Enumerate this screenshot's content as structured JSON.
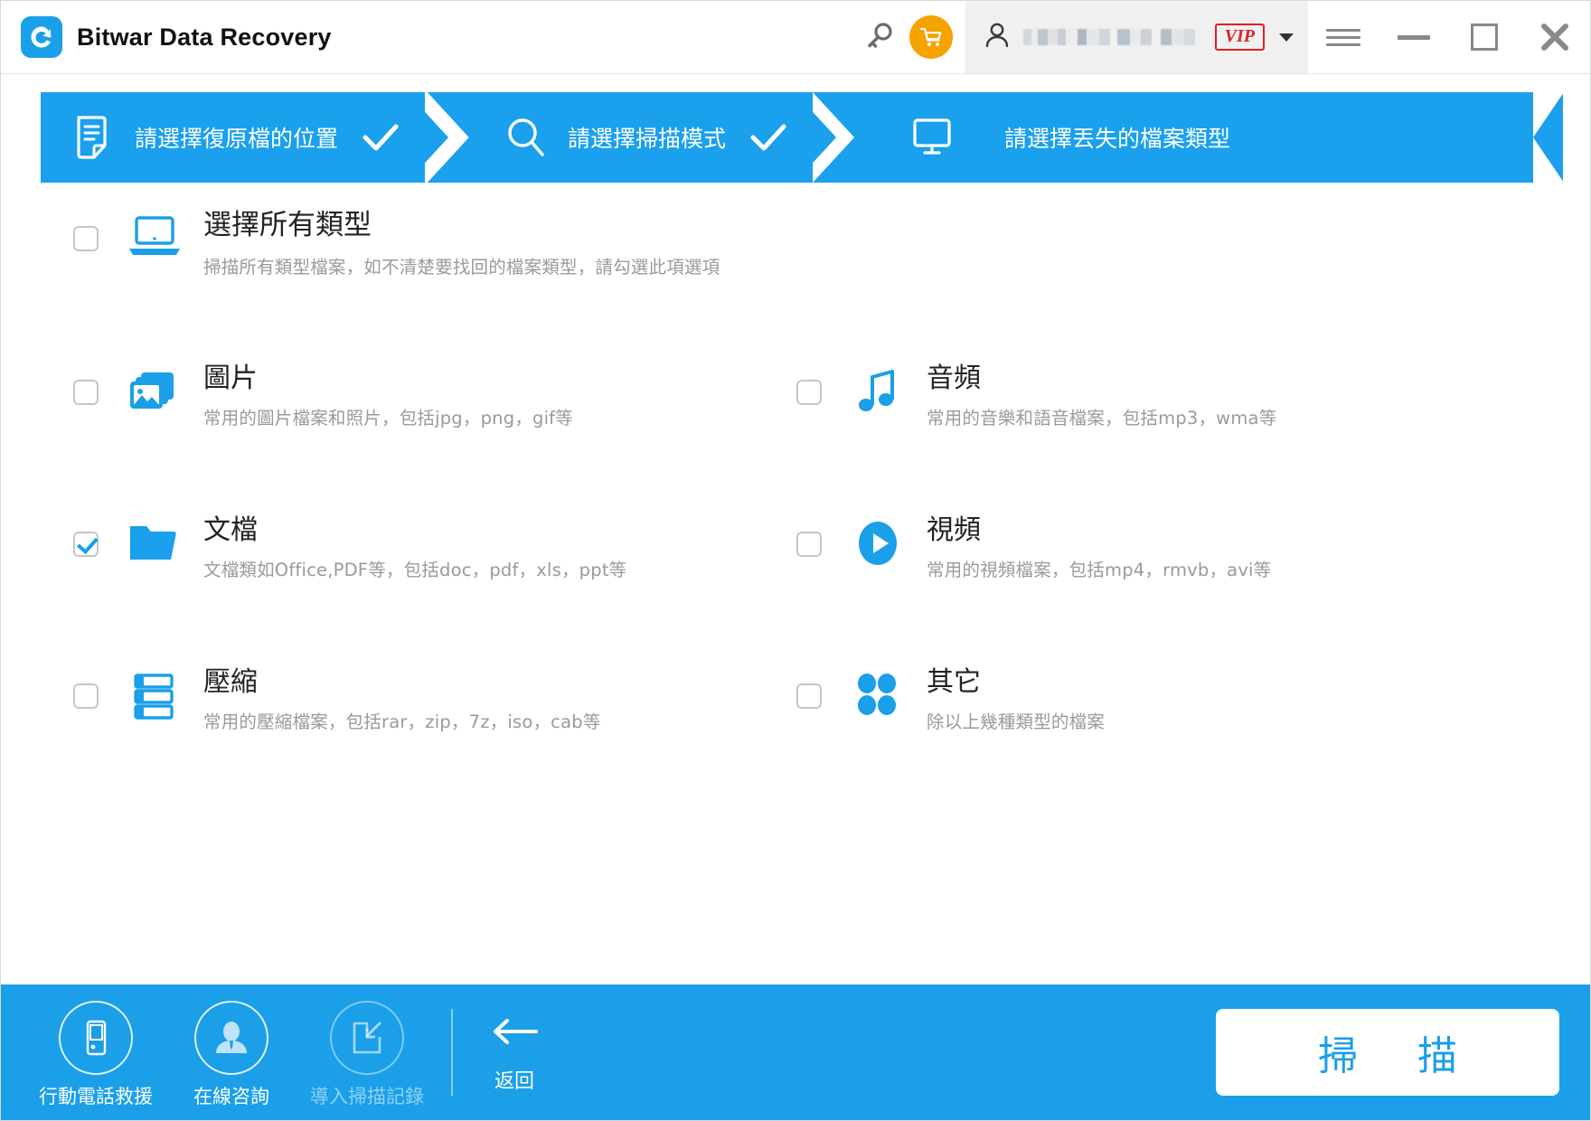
{
  "window": {
    "title": "Bitwar Data Recovery",
    "logo_icon": "bitwar-logo-icon",
    "controls": {
      "key_icon": "key-icon",
      "cart_icon": "shopping-cart-icon",
      "account_icon": "user-account-icon",
      "account_name_masked": "",
      "vip_badge": "VIP",
      "dropdown_icon": "chevron-down-icon",
      "menu_icon": "hamburger-menu-icon",
      "minimize_icon": "minimize-icon",
      "maximize_icon": "maximize-icon",
      "close_icon": "close-icon"
    }
  },
  "steps": [
    {
      "icon": "document-icon",
      "label": "請選擇復原檔的位置",
      "completed": true
    },
    {
      "icon": "search-icon",
      "label": "請選擇掃描模式",
      "completed": true
    },
    {
      "icon": "monitor-icon",
      "label": "請選擇丟失的檔案類型",
      "completed": false
    }
  ],
  "file_types": [
    {
      "id": "all",
      "icon": "laptop-icon",
      "title": "選擇所有類型",
      "desc": "掃描所有類型檔案，如不清楚要找回的檔案類型，請勾選此項選項",
      "checked": false
    },
    {
      "id": "image",
      "icon": "picture-icon",
      "title": "圖片",
      "desc": "常用的圖片檔案和照片，包括jpg，png，gif等",
      "checked": false
    },
    {
      "id": "audio",
      "icon": "music-note-icon",
      "title": "音頻",
      "desc": "常用的音樂和語音檔案，包括mp3，wma等",
      "checked": false
    },
    {
      "id": "document",
      "icon": "folder-icon",
      "title": "文檔",
      "desc": "文檔類如Office,PDF等，包括doc，pdf，xls，ppt等",
      "checked": true
    },
    {
      "id": "video",
      "icon": "play-circle-icon",
      "title": "視頻",
      "desc": "常用的視頻檔案，包括mp4，rmvb，avi等",
      "checked": false
    },
    {
      "id": "archive",
      "icon": "archive-stack-icon",
      "title": "壓縮",
      "desc": "常用的壓縮檔案，包括rar，zip，7z，iso，cab等",
      "checked": false
    },
    {
      "id": "other",
      "icon": "four-dots-icon",
      "title": "其它",
      "desc": "除以上幾種類型的檔案",
      "checked": false
    }
  ],
  "bottom_bar": {
    "tools": [
      {
        "id": "mobile-rescue",
        "icon": "mobile-phone-icon",
        "label": "行動電話救援",
        "disabled": false
      },
      {
        "id": "online-consult",
        "icon": "person-support-icon",
        "label": "在線咨詢",
        "disabled": false
      },
      {
        "id": "import-scan-log",
        "icon": "import-file-icon",
        "label": "導入掃描記錄",
        "disabled": true
      }
    ],
    "back": {
      "icon": "arrow-left-icon",
      "label": "返回"
    },
    "scan_button": "掃  描"
  },
  "colors": {
    "accent_blue": "#1a9fe8",
    "banner_blue": "#1aa0ec",
    "cart_orange": "#f5a300",
    "vip_red": "#e02020"
  }
}
